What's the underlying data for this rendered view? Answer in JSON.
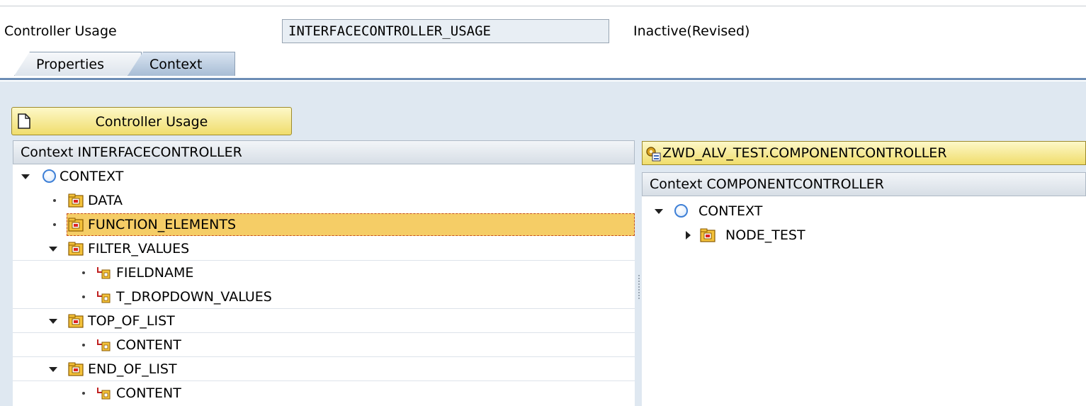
{
  "header": {
    "label": "Controller Usage",
    "field_value": "INTERFACECONTROLLER_USAGE",
    "status": "Inactive(Revised)"
  },
  "tabs": [
    {
      "label": "Properties",
      "active": false
    },
    {
      "label": "Context",
      "active": true
    }
  ],
  "toolbar": {
    "controller_usage_button": "Controller Usage"
  },
  "left_panel": {
    "header": "Context INTERFACECONTROLLER",
    "rows": [
      {
        "label": "CONTEXT",
        "kind": "root",
        "expanded": true,
        "level": 0
      },
      {
        "label": "DATA",
        "kind": "node",
        "level": 1
      },
      {
        "label": "FUNCTION_ELEMENTS",
        "kind": "node",
        "level": 1,
        "selected": true
      },
      {
        "label": "FILTER_VALUES",
        "kind": "node",
        "expanded": true,
        "level": 1
      },
      {
        "label": "FIELDNAME",
        "kind": "attribute",
        "level": 2
      },
      {
        "label": "T_DROPDOWN_VALUES",
        "kind": "attribute",
        "level": 2
      },
      {
        "label": "TOP_OF_LIST",
        "kind": "node",
        "expanded": true,
        "level": 1
      },
      {
        "label": "CONTENT",
        "kind": "attribute",
        "level": 2
      },
      {
        "label": "END_OF_LIST",
        "kind": "node",
        "expanded": true,
        "level": 1
      },
      {
        "label": "CONTENT",
        "kind": "attribute",
        "level": 2
      }
    ]
  },
  "right_panel": {
    "title": "ZWD_ALV_TEST.COMPONENTCONTROLLER",
    "header": "Context COMPONENTCONTROLLER",
    "rows": [
      {
        "label": "CONTEXT",
        "kind": "root",
        "expanded": true,
        "level": 0
      },
      {
        "label": "NODE_TEST",
        "kind": "node",
        "expanded": false,
        "level": 1
      }
    ]
  },
  "colors": {
    "accent_yellow": "#f0dd6c",
    "selection": "#f5cd66",
    "tab_line": "#6c8db5",
    "circle_blue": "#3d7fd6"
  }
}
